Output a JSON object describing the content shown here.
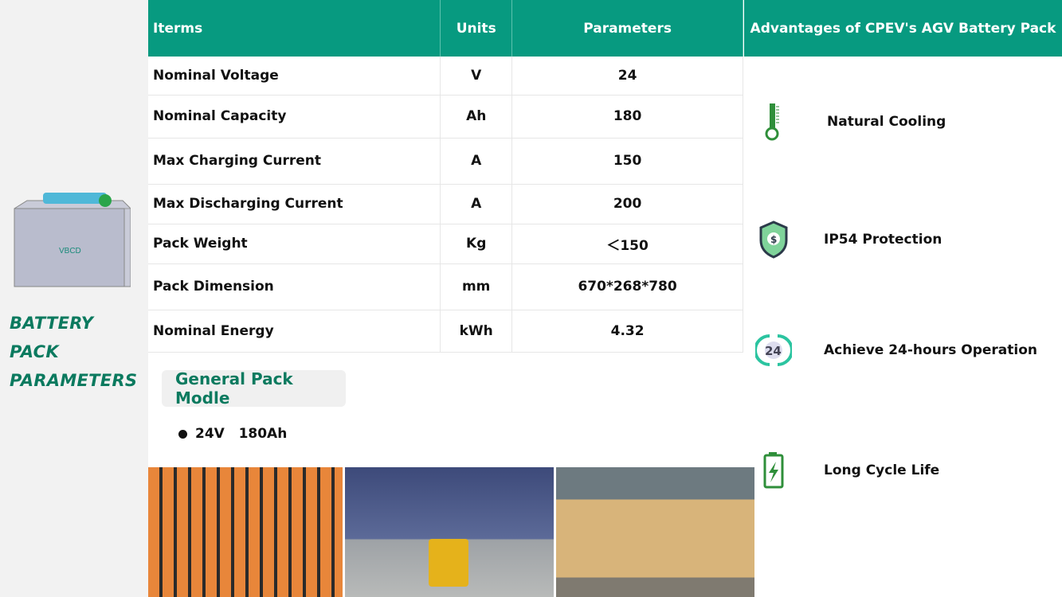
{
  "sidebar": {
    "title_line1": "BATTERY PACK",
    "title_line2": "PARAMETERS"
  },
  "table": {
    "headers": [
      "Iterms",
      "Units",
      "Parameters"
    ],
    "rows": [
      [
        "Nominal Voltage",
        "V",
        "24"
      ],
      [
        "Nominal Capacity",
        "Ah",
        "180"
      ],
      [
        "Max Charging Current",
        "A",
        "150"
      ],
      [
        "Max Discharging Current",
        "A",
        "200"
      ],
      [
        "Pack Weight",
        "Kg",
        "＜150"
      ],
      [
        "Pack Dimension",
        "mm",
        "670*268*780"
      ],
      [
        "Nominal Energy",
        "kWh",
        "4.32"
      ]
    ]
  },
  "advantages": {
    "title": "Advantages of CPEV's AGV Battery Pack",
    "items": [
      {
        "label": "Natural Cooling",
        "icon": "thermometer-icon"
      },
      {
        "label": "IP54 Protection",
        "icon": "shield-icon"
      },
      {
        "label": "Achieve 24-hours Operation",
        "icon": "24-hours-icon",
        "icon_text": "24"
      },
      {
        "label": "Long Cycle Life",
        "icon": "battery-charging-icon"
      }
    ]
  },
  "model": {
    "title": "General Pack Modle",
    "spec": "24V   180Ah"
  },
  "colors": {
    "teal": "#079a80",
    "green": "#0b7a5f"
  }
}
